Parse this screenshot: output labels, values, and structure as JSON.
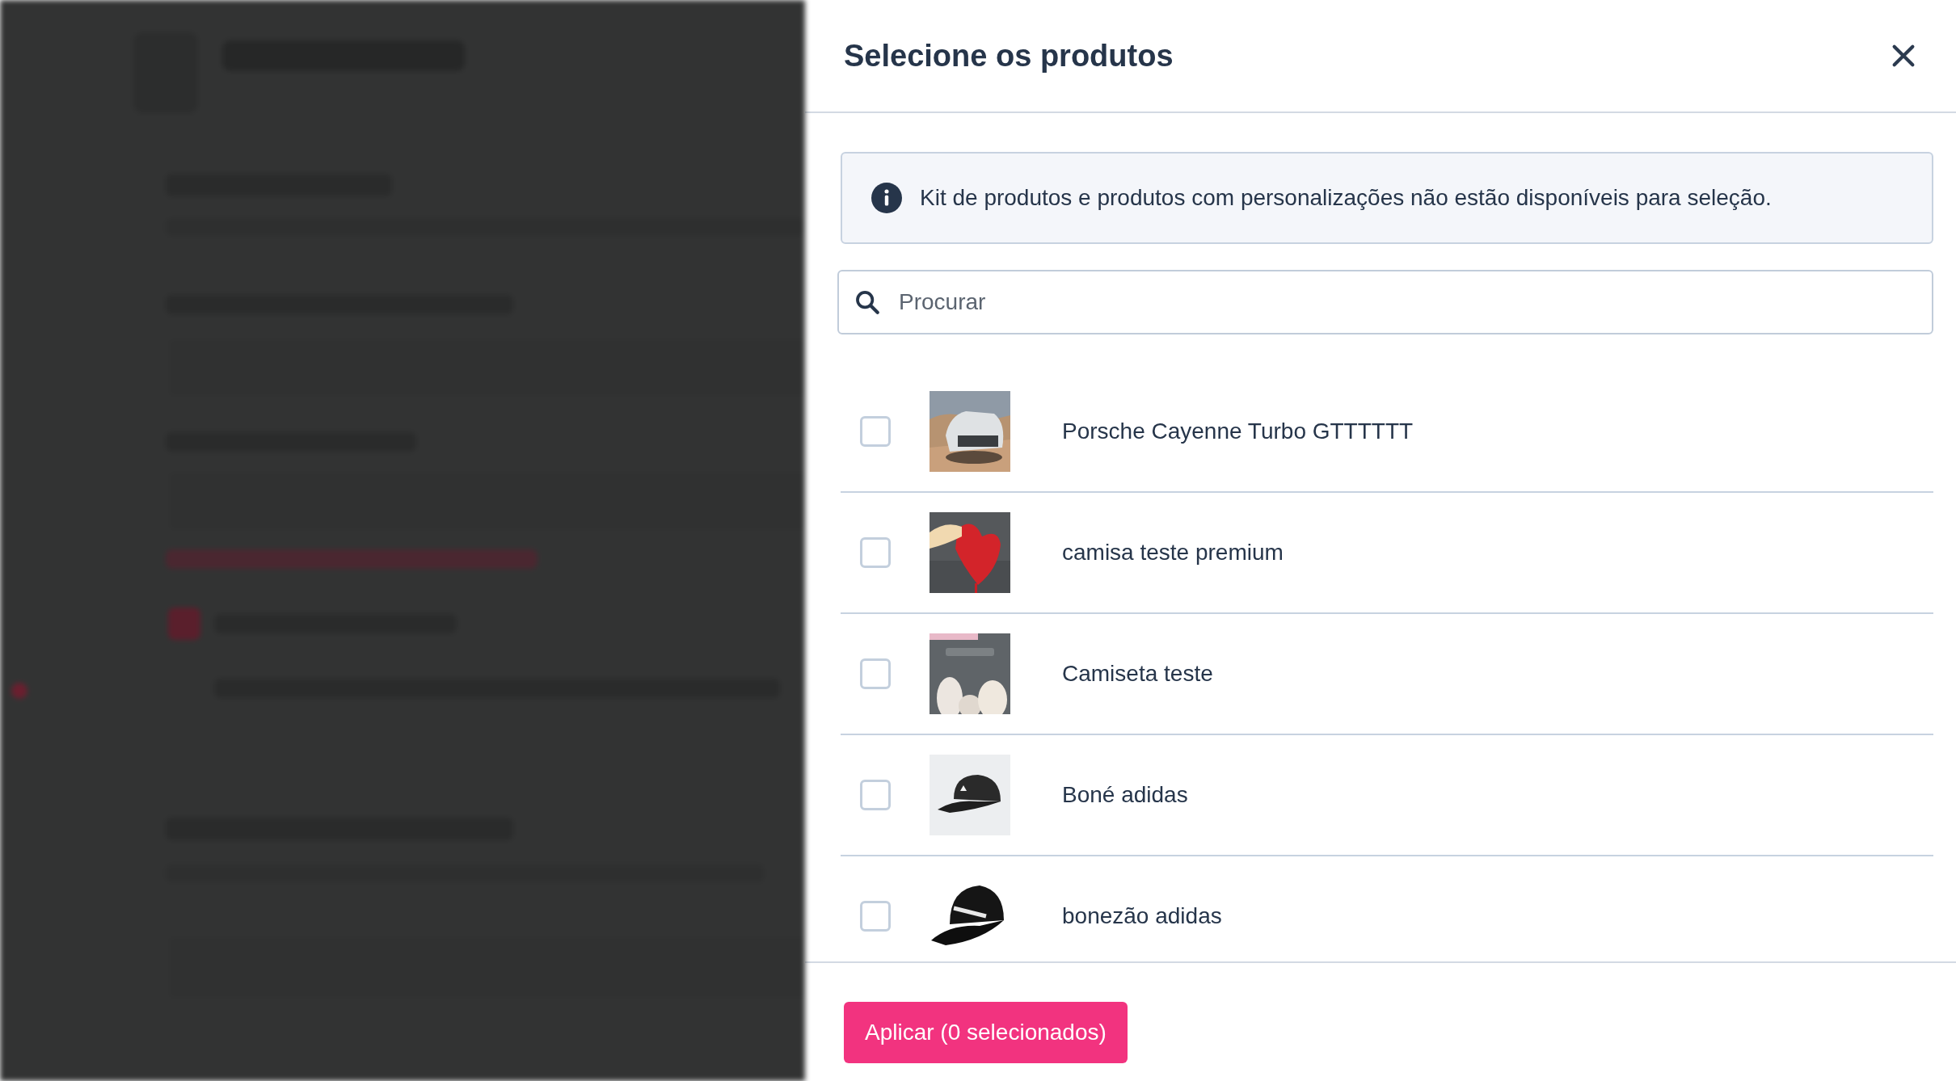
{
  "modal": {
    "title": "Selecione os produtos",
    "info": "Kit de produtos e produtos com personalizações não estão disponíveis para seleção.",
    "search": {
      "placeholder": "Procurar"
    },
    "products": [
      {
        "name": "Porsche Cayenne Turbo GTTTTTT",
        "checked": false
      },
      {
        "name": "camisa teste premium",
        "checked": false
      },
      {
        "name": "Camiseta teste",
        "checked": false
      },
      {
        "name": "Boné adidas",
        "checked": false
      },
      {
        "name": "bonezão adidas",
        "checked": false
      }
    ],
    "apply_button": "Aplicar (0 selecionados)"
  }
}
